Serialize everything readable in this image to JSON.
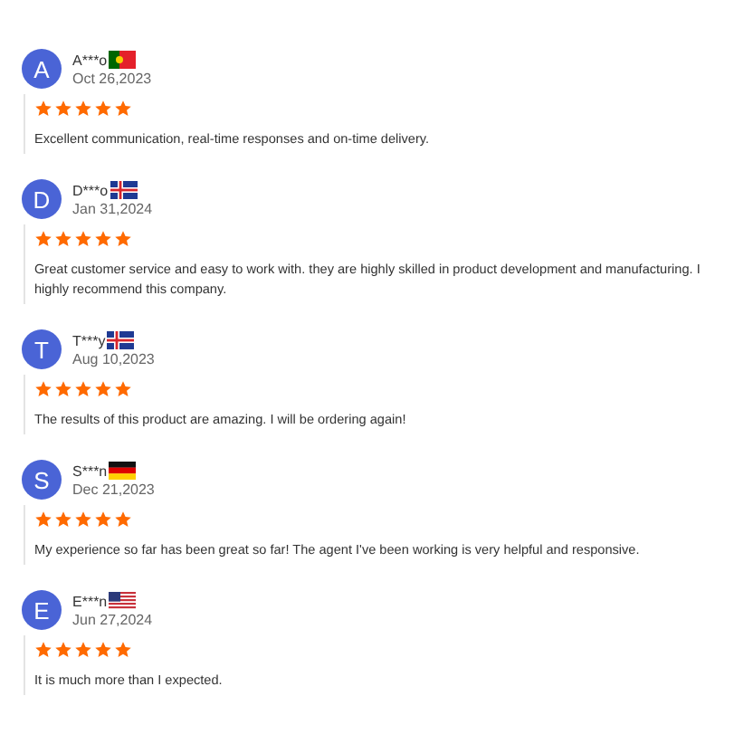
{
  "reviews": [
    {
      "initial": "A",
      "name": "A***o",
      "kind": "pt",
      "date": "Oct 26,2023",
      "stars": 5,
      "text": "Excellent communication, real-time responses and on-time delivery."
    },
    {
      "initial": "D",
      "name": "D***o",
      "kind": "is",
      "date": "Jan 31,2024",
      "stars": 5,
      "text": "Great customer service and easy to work with. they are highly skilled in product development and manufacturing. I highly recommend this company."
    },
    {
      "initial": "T",
      "name": "T***y",
      "kind": "is",
      "date": "Aug 10,2023",
      "stars": 5,
      "text": "The results of this product are amazing. I will be ordering again!"
    },
    {
      "initial": "S",
      "name": "S***n",
      "kind": "de",
      "date": "Dec 21,2023",
      "stars": 5,
      "text": "My experience so far has been great so far! The agent I've been working is very helpful and responsive."
    },
    {
      "initial": "E",
      "name": "E***n",
      "kind": "us",
      "date": "Jun 27,2024",
      "stars": 5,
      "text": "It is much more than I expected."
    }
  ]
}
